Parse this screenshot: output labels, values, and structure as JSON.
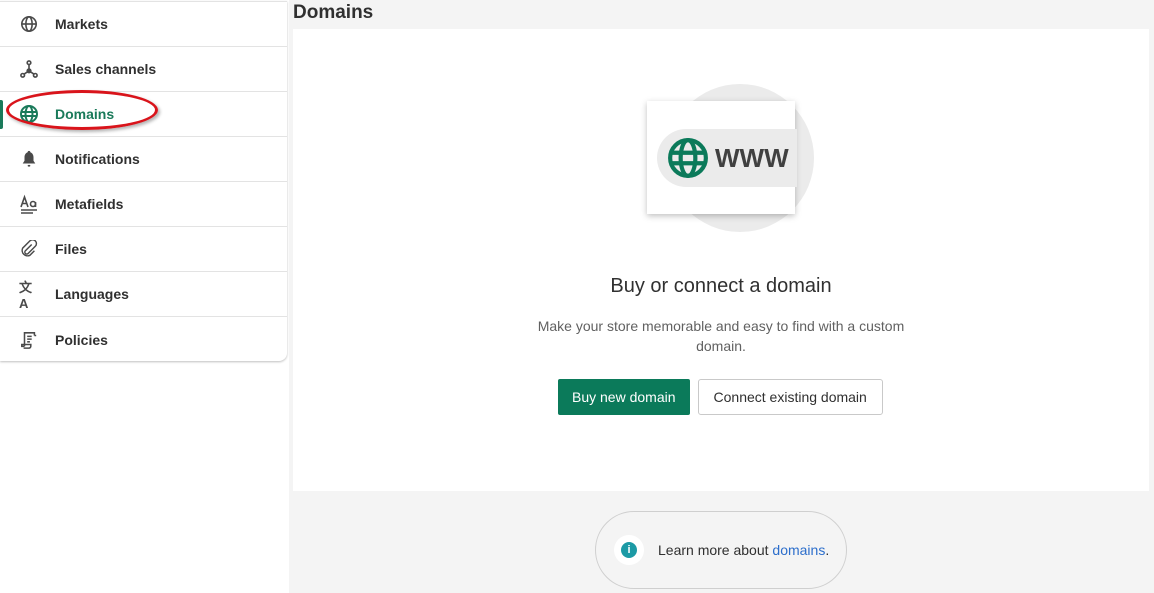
{
  "sidebar": {
    "items": [
      {
        "label": "Markets",
        "icon": "globe-icon"
      },
      {
        "label": "Sales channels",
        "icon": "network-icon"
      },
      {
        "label": "Domains",
        "icon": "globe-cursor-icon",
        "active": true
      },
      {
        "label": "Notifications",
        "icon": "bell-icon"
      },
      {
        "label": "Metafields",
        "icon": "text-format-icon"
      },
      {
        "label": "Files",
        "icon": "paperclip-icon"
      },
      {
        "label": "Languages",
        "icon": "translate-icon"
      },
      {
        "label": "Policies",
        "icon": "document-icon"
      }
    ]
  },
  "page": {
    "title": "Domains"
  },
  "empty_state": {
    "illustration_text": "WWW",
    "title": "Buy or connect a domain",
    "description": "Make your store memorable and easy to find with a custom domain.",
    "primary_button": "Buy new domain",
    "secondary_button": "Connect existing domain"
  },
  "footer": {
    "text": "Learn more about ",
    "link": "domains",
    "suffix": "."
  },
  "colors": {
    "accent": "#0b7a5a",
    "highlight": "#d9141b",
    "link": "#2c6ecb"
  }
}
